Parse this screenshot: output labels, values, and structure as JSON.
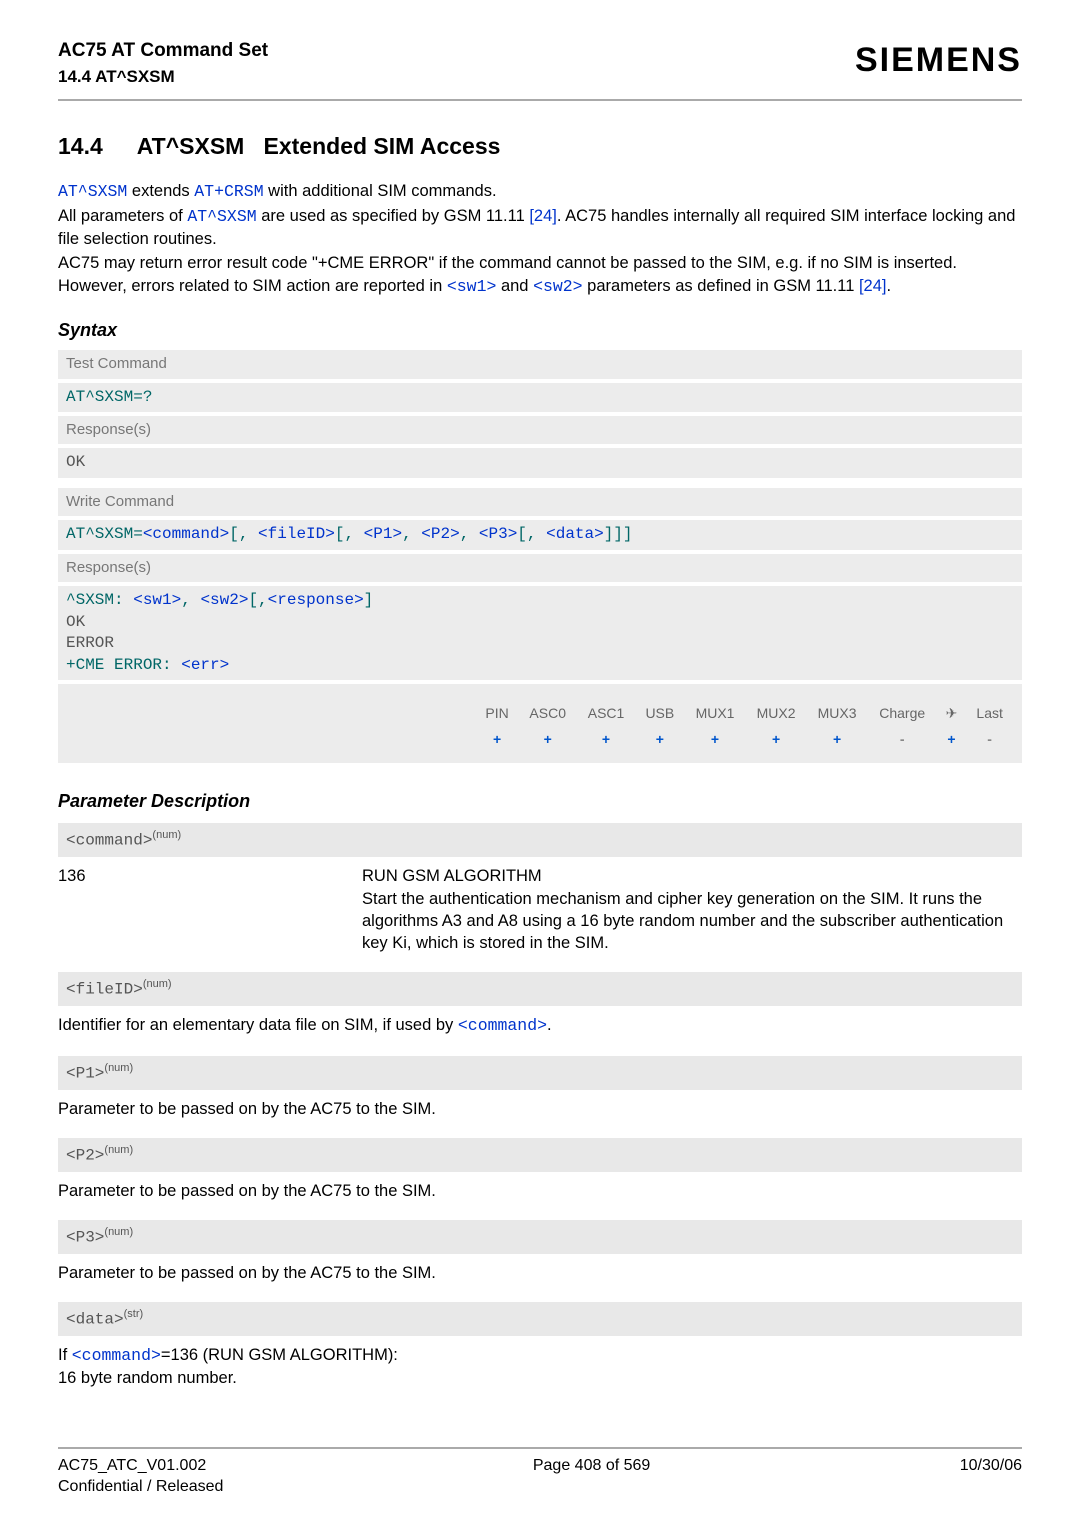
{
  "header": {
    "product": "AC75 AT Command Set",
    "section": "14.4 AT^SXSM",
    "brand": "SIEMENS"
  },
  "title": {
    "num": "14.4",
    "cmd": "AT^SXSM",
    "rest": "Extended SIM Access"
  },
  "intro": {
    "l1a": "AT^SXSM",
    "l1b": " extends ",
    "l1c": "AT+CRSM",
    "l1d": " with additional SIM commands.",
    "l2a": "All parameters of ",
    "l2b": "AT^SXSM",
    "l2c": " are used as specified by GSM 11.11 ",
    "l2d": "[24]",
    "l2e": ". AC75 handles internally all required SIM interface locking and file selection routines.",
    "l3a": "AC75 may return error result code \"+CME ERROR\" if the command cannot be passed to the SIM, e.g. if no SIM is inserted. However, errors related to SIM action are reported in ",
    "l3b": "<sw1>",
    "l3c": " and ",
    "l3d": "<sw2>",
    "l3e": " parameters as defined in GSM 11.11 ",
    "l3f": "[24]",
    "l3g": "."
  },
  "syntax": {
    "heading": "Syntax",
    "test_label": "Test Command",
    "test_cmd": "AT^SXSM=?",
    "resp_label": "Response(s)",
    "ok": "OK",
    "write_label": "Write Command",
    "write_prefix": "AT^SXSM=",
    "p_command": "<command>",
    "br1": "[, ",
    "p_fileID": "<fileID>",
    "br2": "[, ",
    "p_P1": "<P1>",
    "comma1": ", ",
    "p_P2": "<P2>",
    "comma2": ", ",
    "p_P3": "<P3>",
    "br3": "[, ",
    "p_data": "<data>",
    "close": "]]]",
    "resp2_prefix": "^SXSM: ",
    "p_sw1": "<sw1>",
    "comma3": ", ",
    "p_sw2": "<sw2>",
    "br4": "[,",
    "p_response": "<response>",
    "br5": "]",
    "error": "ERROR",
    "cme_prefix": "+CME ERROR: ",
    "p_err": "<err>"
  },
  "platforms": {
    "headers": [
      "PIN",
      "ASC0",
      "ASC1",
      "USB",
      "MUX1",
      "MUX2",
      "MUX3",
      "Charge",
      "✈",
      "Last"
    ],
    "values": [
      "+",
      "+",
      "+",
      "+",
      "+",
      "+",
      "+",
      "-",
      "+",
      "-"
    ]
  },
  "params": {
    "heading": "Parameter Description",
    "command": {
      "head": "<command>",
      "sup": "(num)",
      "val": "136",
      "name": "RUN GSM ALGORITHM",
      "desc": "Start the authentication mechanism and cipher key generation on the SIM. It runs the algorithms A3 and A8 using a 16 byte random number and the sub­scriber authentication key Ki, which is stored in the SIM."
    },
    "fileID": {
      "head": "<fileID>",
      "sup": "(num)",
      "desc_a": "Identifier for an elementary data file on SIM, if used by ",
      "desc_b": "<command>",
      "desc_c": "."
    },
    "P1": {
      "head": "<P1>",
      "sup": "(num)",
      "desc": "Parameter to be passed on by the AC75 to the SIM."
    },
    "P2": {
      "head": "<P2>",
      "sup": "(num)",
      "desc": "Parameter to be passed on by the AC75 to the SIM."
    },
    "P3": {
      "head": "<P3>",
      "sup": "(num)",
      "desc": "Parameter to be passed on by the AC75 to the SIM."
    },
    "data": {
      "head": "<data>",
      "sup": "(str)",
      "desc_a": "If ",
      "desc_b": "<command>",
      "desc_c": "=136 (RUN GSM ALGORITHM):",
      "desc_d": "16 byte random number."
    }
  },
  "footer": {
    "doc": "AC75_ATC_V01.002",
    "conf": "Confidential / Released",
    "page": "Page 408 of 569",
    "date": "10/30/06"
  }
}
